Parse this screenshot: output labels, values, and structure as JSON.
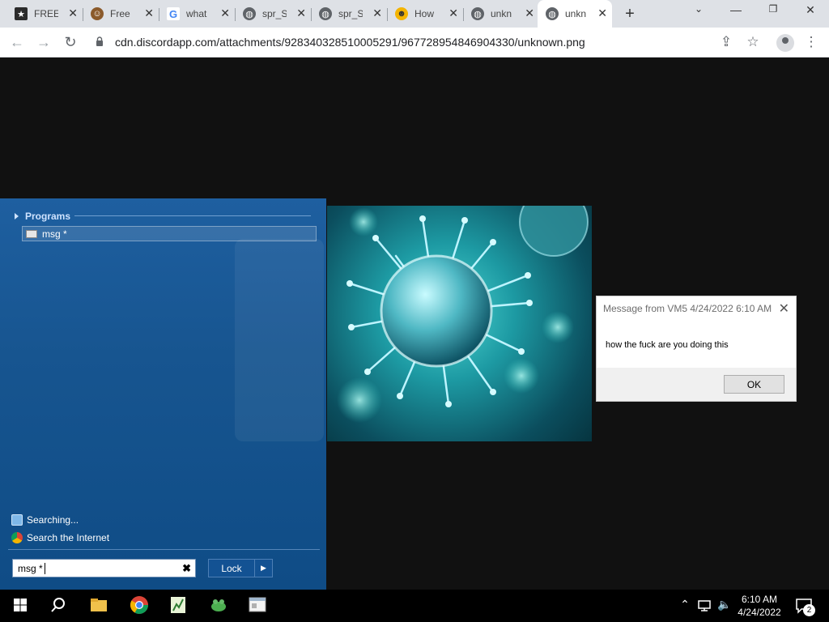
{
  "browser": {
    "tabs": [
      {
        "title": "FREE",
        "icon": "game-icon",
        "color": "#2b2b2b"
      },
      {
        "title": "Free",
        "icon": "avatar-icon",
        "color": "#8b5a2b"
      },
      {
        "title": "what",
        "icon": "google-icon",
        "color": "#4285f4"
      },
      {
        "title": "spr_S",
        "icon": "globe-icon",
        "color": "#5f6368"
      },
      {
        "title": "spr_S",
        "icon": "globe-icon",
        "color": "#5f6368"
      },
      {
        "title": "How",
        "icon": "emoji-icon",
        "color": "#f4b400"
      },
      {
        "title": "unkn",
        "icon": "globe-icon",
        "color": "#5f6368"
      },
      {
        "title": "unkn",
        "icon": "globe-icon",
        "color": "#5f6368"
      }
    ],
    "active_tab": 7,
    "url": "cdn.discordapp.com/attachments/928340328510005291/967728954846904330/unknown.png"
  },
  "start_menu": {
    "programs_header": "Programs",
    "program_item": "msg *",
    "searching": "Searching...",
    "search_internet": "Search the Internet",
    "search_value": "msg *",
    "clear_glyph": "✖",
    "lock_label": "Lock"
  },
  "dialog": {
    "title": "Message from VM5 4/24/2022 6:10 AM",
    "message": "how the fuck are you doing this",
    "ok_label": "OK"
  },
  "taskbar": {
    "time": "6:10 AM",
    "date": "4/24/2022",
    "notification_count": "2"
  },
  "colors": {
    "start_menu_bg": "#175590",
    "page_bg": "#111111",
    "accent": "#76b9ed"
  }
}
